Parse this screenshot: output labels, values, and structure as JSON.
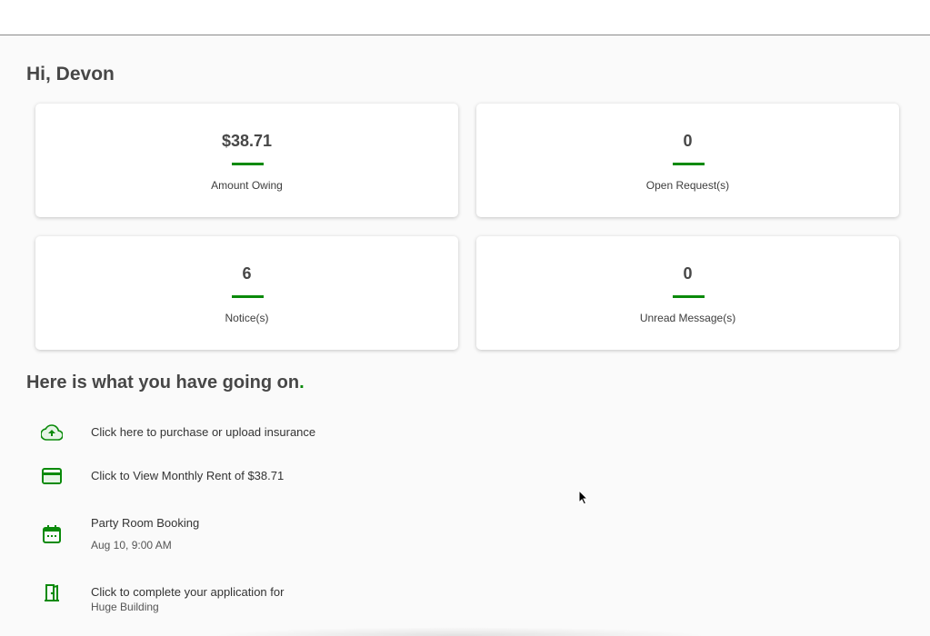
{
  "greeting": "Hi, Devon",
  "stats": [
    {
      "value": "$38.71",
      "label": "Amount Owing"
    },
    {
      "value": "0",
      "label": "Open Request(s)"
    },
    {
      "value": "6",
      "label": "Notice(s)"
    },
    {
      "value": "0",
      "label": "Unread Message(s)"
    }
  ],
  "section": {
    "title": "Here is what you have going on",
    "dot": "."
  },
  "activities": [
    {
      "icon": "cloud-upload-icon",
      "text": "Click here to purchase or upload insurance"
    },
    {
      "icon": "credit-card-icon",
      "text": "Click to View Monthly Rent of $38.71"
    },
    {
      "icon": "calendar-icon",
      "text": "Party Room Booking",
      "sub": "Aug 10, 9:00 AM"
    },
    {
      "icon": "door-icon",
      "text": "Click to complete your application for",
      "sub": "Huge Building"
    }
  ],
  "colors": {
    "accent": "#0a8a0a",
    "background": "#fafafa",
    "text": "#474747"
  }
}
